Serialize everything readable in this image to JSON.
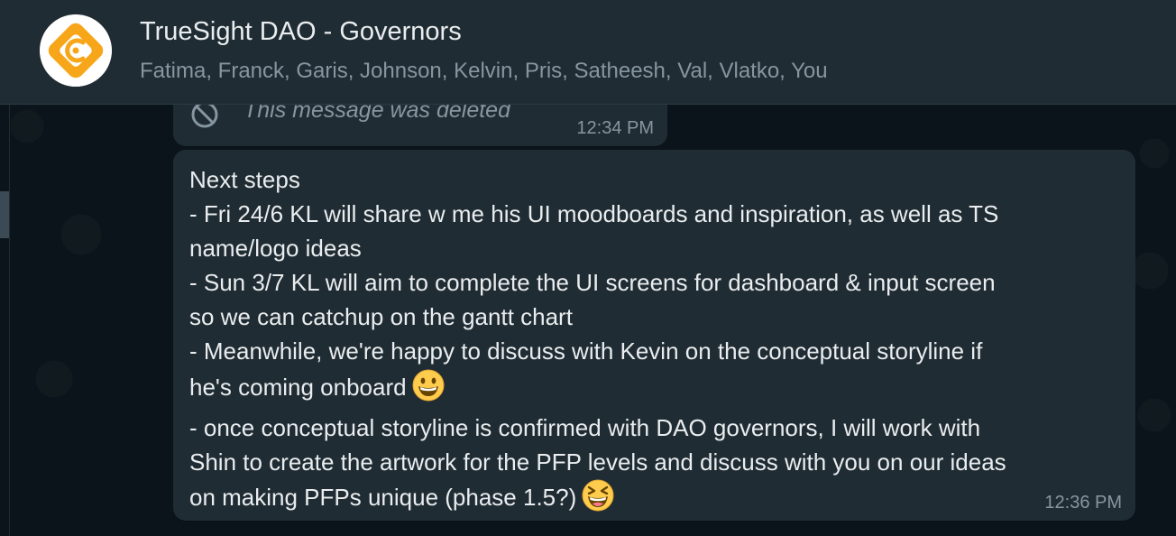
{
  "header": {
    "group_name": "TrueSight DAO - Governors",
    "members": "Fatima, Franck, Garis, Johnson, Kelvin, Pris, Satheesh, Val, Vlatko, You",
    "avatar_icon": "truesight-logo-icon",
    "colors": {
      "avatar_orange": "#f7a619",
      "header_bg": "#202c33"
    }
  },
  "messages": {
    "deleted": {
      "text": "This message was deleted",
      "time": "12:34 PM",
      "icon": "block-icon"
    },
    "main": {
      "lines": [
        "Next steps",
        "- Fri 24/6 KL will share w me his UI moodboards and inspiration, as well as TS",
        "name/logo ideas",
        "- Sun 3/7 KL will aim to complete the UI screens for dashboard & input screen",
        "so we can catchup on the gantt chart",
        "- Meanwhile, we're happy to discuss with Kevin on the conceptual storyline if",
        "he's coming onboard",
        "- once conceptual storyline is confirmed with DAO governors, I will work with",
        "Shin to create the artwork for the PFP levels and discuss with you on our ideas",
        "on making PFPs unique (phase 1.5?)"
      ],
      "emojis": [
        "grinning-face-emoji",
        "laughing-squinting-face-emoji"
      ],
      "time": "12:36 PM"
    }
  }
}
